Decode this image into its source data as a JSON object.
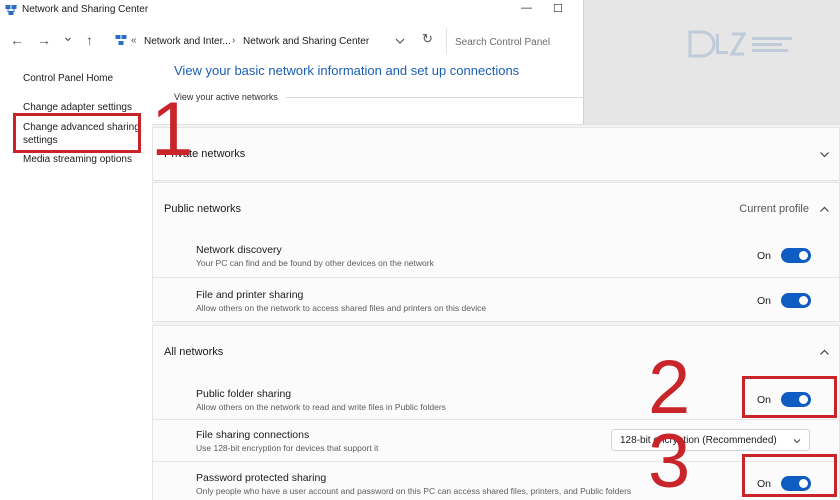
{
  "window": {
    "title": "Network and Sharing Center",
    "minimize_glyph": "—",
    "maximize_glyph": "☐",
    "app_icon": "network-center-icon"
  },
  "address_bar": {
    "back_glyph": "←",
    "forward_glyph": "→",
    "recent_glyph": "⌄",
    "up_glyph": "↑",
    "overflow_glyph": "«",
    "crumb_1": "Network and Inter...",
    "separator_glyph": "›",
    "crumb_2": "Network and Sharing Center",
    "refresh_glyph": "↻",
    "search_placeholder": "Search Control Panel"
  },
  "control_panel": {
    "nav": {
      "home": "Control Panel Home",
      "adapter": "Change adapter settings",
      "advanced_line1": "Change advanced sharing",
      "advanced_line2": "settings",
      "media": "Media streaming options"
    },
    "main_title": "View your basic network information and set up connections",
    "active_networks": "View your active networks"
  },
  "watermark": {
    "text": "DLZ TECH"
  },
  "advanced": {
    "private": {
      "label": "Private networks",
      "expanded": false
    },
    "public": {
      "label": "Public networks",
      "aside": "Current profile",
      "expanded": true,
      "settings": [
        {
          "title": "Network discovery",
          "desc": "Your PC can find and be found by other devices on the network",
          "state": "On"
        },
        {
          "title": "File and printer sharing",
          "desc": "Allow others on the network to access shared files and printers on this device",
          "state": "On"
        }
      ]
    },
    "all": {
      "label": "All networks",
      "expanded": true,
      "public_folder": {
        "title": "Public folder sharing",
        "desc": "Allow others on the network to read and write files in Public folders",
        "state": "On"
      },
      "connections": {
        "title": "File sharing connections",
        "desc": "Use 128-bit encryption for devices that support it",
        "selected": "128-bit encryption (Recommended)"
      },
      "password": {
        "title": "Password protected sharing",
        "desc": "Only people who have a user account and password on this PC can access shared files, printers, and Public folders",
        "state": "On"
      }
    }
  },
  "annotations": {
    "step1": "1",
    "step2": "2",
    "step3": "3",
    "color": "#c8242a"
  },
  "colors": {
    "accent": "#0f5cc2",
    "link": "#1a5fb4",
    "highlight": "#c8242a"
  }
}
